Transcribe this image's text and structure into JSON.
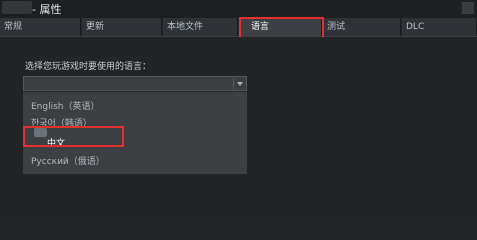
{
  "window": {
    "title": "- 属性"
  },
  "tabs": [
    {
      "label": "常规"
    },
    {
      "label": "更新"
    },
    {
      "label": "本地文件"
    },
    {
      "label": "语言"
    },
    {
      "label": "测试"
    },
    {
      "label": "DLC"
    }
  ],
  "language": {
    "prompt": "选择您玩游戏时要使用的语言：",
    "selected_value": "",
    "options": [
      {
        "label": "English（英语）"
      },
      {
        "label": "한국어（韩语）"
      },
      {
        "label": "中文"
      },
      {
        "label": "Pусский（俄语）"
      }
    ]
  },
  "colors": {
    "highlight_box": "#e03030",
    "background": "#242628",
    "dropdown": "#3d4043"
  },
  "icons": {
    "close": "close-icon",
    "app": "app-icon",
    "dropdown": "chevron-down-icon",
    "flag": "flag-icon"
  }
}
